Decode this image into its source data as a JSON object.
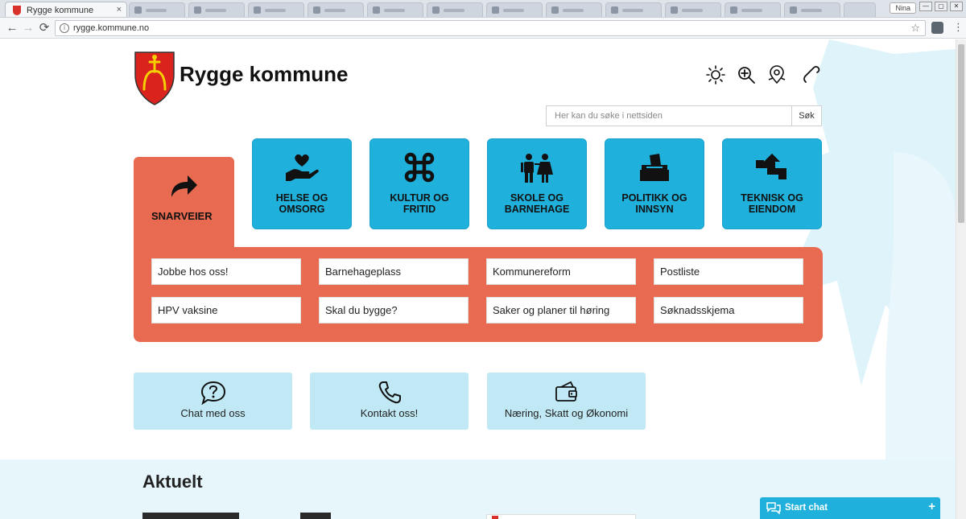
{
  "browser": {
    "active_tab_title": "Rygge kommune",
    "tab_close": "×",
    "url": "rygge.kommune.no",
    "user_badge": "Nina",
    "window_buttons": [
      "—",
      "▢",
      "✕"
    ],
    "nav_back": "←",
    "nav_forward": "→",
    "nav_reload": "⟳",
    "info_glyph": "i",
    "star_glyph": "☆",
    "menu_glyph": "⋮"
  },
  "header": {
    "site_title": "Rygge kommune",
    "tools": [
      "brightness-icon",
      "zoom-in-icon",
      "map-pin-icon",
      "phone-icon"
    ]
  },
  "search": {
    "placeholder": "Her kan du søke i nettsiden",
    "button_label": "Søk"
  },
  "snarveier": {
    "label": "SNARVEIER",
    "links": [
      "Jobbe hos oss!",
      "Barnehageplass",
      "Kommunereform",
      "Postliste",
      "HPV vaksine",
      "Skal du bygge?",
      "Saker og planer til høring",
      "Søknadsskjema"
    ]
  },
  "categories": [
    {
      "label": "HELSE OG OMSORG",
      "icon": "heart-hand-icon"
    },
    {
      "label": "KULTUR OG FRITID",
      "icon": "command-icon"
    },
    {
      "label": "SKOLE OG BARNEHAGE",
      "icon": "children-icon"
    },
    {
      "label": "POLITIKK OG INNSYN",
      "icon": "ballot-box-icon"
    },
    {
      "label": "TEKNISK OG EIENDOM",
      "icon": "pipe-icon"
    }
  ],
  "quick_links": [
    {
      "label": "Chat med oss",
      "icon": "chat-question-icon"
    },
    {
      "label": "Kontakt oss!",
      "icon": "phone-icon"
    },
    {
      "label": "Næring, Skatt og Økonomi",
      "icon": "wallet-icon"
    }
  ],
  "aktuelt": {
    "title": "Aktuelt"
  },
  "chat_widget": {
    "label": "Start chat",
    "plus": "+"
  },
  "colors": {
    "snarveier_orange": "#e86a50",
    "category_blue": "#1fb1dc",
    "quick_link_bg": "#c0e9f5",
    "aktuelt_bg": "#e7f6fb"
  }
}
